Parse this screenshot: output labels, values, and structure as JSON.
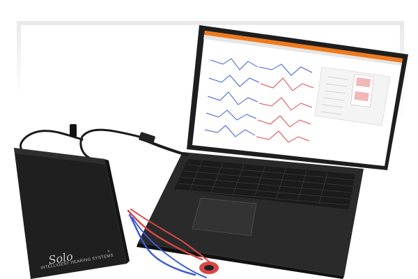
{
  "photo": {
    "device": {
      "brand": "Solo",
      "subtitle": "INTELLIGENT HEARING SYSTEMS"
    },
    "laptop": {
      "app_accent_color": "#f07a1c",
      "screen_bg": "#ffffff"
    },
    "colors": {
      "trace_blue": "#3c5bd6",
      "trace_red": "#d84848",
      "device_body": "#1f1f1f",
      "laptop_body": "#2b2b2b"
    }
  }
}
